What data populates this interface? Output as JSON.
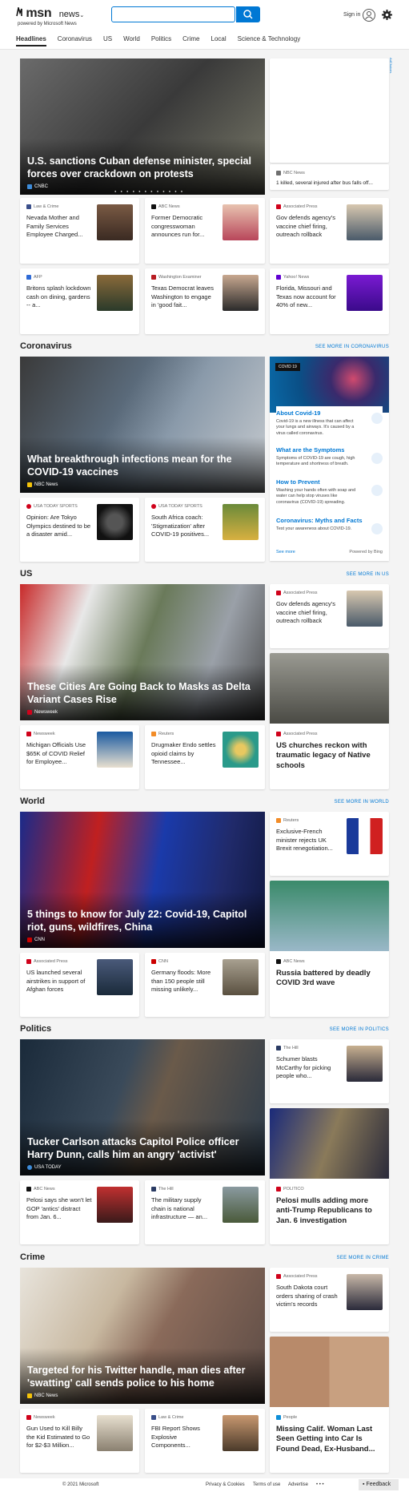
{
  "header": {
    "brand": "msn",
    "section": "news",
    "powered": "powered by Microsoft News",
    "search_placeholder": "",
    "signin": "Sign in"
  },
  "nav": [
    "Headlines",
    "Coronavirus",
    "US",
    "World",
    "Politics",
    "Crime",
    "Local",
    "Science & Technology"
  ],
  "adchoices": "AdChoices",
  "headlines": {
    "hero": {
      "title": "U.S. sanctions Cuban defense minister, special forces over crackdown on protests",
      "source": "CNBC"
    },
    "side_card": {
      "source": "NBC News",
      "title": "1 killed, several injured after bus falls off..."
    },
    "cards": [
      {
        "source": "Law & Crime",
        "title": "Nevada Mother and Family Services Employee Charged...",
        "color": "#3a4f8a"
      },
      {
        "source": "ABC News",
        "title": "Former Democratic congresswoman announces run for...",
        "color": "#111111"
      },
      {
        "source": "Associated Press",
        "title": "Gov defends agency's vaccine chief firing, outreach rollback",
        "color": "#d0021b"
      },
      {
        "source": "AFP",
        "title": "Britons splash lockdown cash on dining, gardens -- a...",
        "color": "#2f6bd6"
      },
      {
        "source": "Washington Examiner",
        "title": "Texas Democrat leaves Washington to engage in 'good fait...",
        "color": "#b81c22"
      },
      {
        "source": "Yahoo! News",
        "title": "Florida, Missouri and Texas now account for 40% of new...",
        "color": "#6001d2"
      }
    ]
  },
  "coronavirus": {
    "title": "Coronavirus",
    "see_more": "SEE MORE IN CORONAVIRUS",
    "hero": {
      "title": "What breakthrough infections mean for the COVID-19 vaccines",
      "source": "NBC News"
    },
    "cards": [
      {
        "source": "USA TODAY SPORTS",
        "title": "Opinion: Are Tokyo Olympics destined to be a disaster amid...",
        "color": "#d0021b"
      },
      {
        "source": "USA TODAY SPORTS",
        "title": "South Africa coach: 'Stigmatization' after COVID-19 positives...",
        "color": "#d0021b"
      }
    ],
    "panel": {
      "badge": "COVID 19",
      "items": [
        {
          "title": "About Covid-19",
          "desc": "Covid-19 is a new illness that can affect your lungs and airways. It's caused by a virus called coronavirus."
        },
        {
          "title": "What are the Symptoms",
          "desc": "Symptoms of COVID-19 are cough, high temperature and shortness of breath."
        },
        {
          "title": "How to Prevent",
          "desc": "Washing your hands often with soap and water can help stop viruses like coronavirus (COVID-19) spreading."
        },
        {
          "title": "Coronavirus: Myths and Facts",
          "desc": "Test your awareness about COVID-19."
        }
      ],
      "see_more": "See more",
      "powered": "Powered by Bing"
    }
  },
  "us": {
    "title": "US",
    "see_more": "SEE MORE IN US",
    "hero": {
      "title": "These Cities Are Going Back to Masks as Delta Variant Cases Rise",
      "source": "Newsweek"
    },
    "side_card": {
      "source": "Associated Press",
      "title": "Gov defends agency's vaccine chief firing, outreach rollback"
    },
    "cards": [
      {
        "source": "Newsweek",
        "title": "Michigan Officials Use $65K of COVID Relief for Employee...",
        "color": "#d0021b"
      },
      {
        "source": "Reuters",
        "title": "Drugmaker Endo settles opioid claims by Tennessee...",
        "color": "#f28c28"
      }
    ],
    "big_card": {
      "source": "Associated Press",
      "title": "US churches reckon with traumatic legacy of Native schools"
    }
  },
  "world": {
    "title": "World",
    "see_more": "SEE MORE IN WORLD",
    "hero": {
      "title": "5 things to know for July 22: Covid-19, Capitol riot, guns, wildfires, China",
      "source": "CNN"
    },
    "side_card": {
      "source": "Reuters",
      "title": "Exclusive-French minister rejects UK Brexit renegotiation..."
    },
    "cards": [
      {
        "source": "Associated Press",
        "title": "US launched several airstrikes in support of Afghan forces",
        "color": "#d0021b"
      },
      {
        "source": "CNN",
        "title": "Germany floods: More than 150 people still missing unlikely...",
        "color": "#cc0000"
      }
    ],
    "big_card": {
      "source": "ABC News",
      "title": "Russia battered by deadly COVID 3rd wave"
    }
  },
  "politics": {
    "title": "Politics",
    "see_more": "SEE MORE IN POLITICS",
    "hero": {
      "title": "Tucker Carlson attacks Capitol Police officer Harry Dunn, calls him an angry 'activist'",
      "source": "USA TODAY"
    },
    "side_card": {
      "source": "The Hill",
      "title": "Schumer blasts McCarthy for picking people who..."
    },
    "cards": [
      {
        "source": "ABC News",
        "title": "Pelosi says she won't let GOP 'antics' distract from Jan. 6...",
        "color": "#111111"
      },
      {
        "source": "The Hill",
        "title": "The military supply chain is national infrastructure — an...",
        "color": "#2a3b63"
      }
    ],
    "big_card": {
      "source": "POLITICO",
      "title": "Pelosi mulls adding more anti-Trump Republicans to Jan. 6 investigation"
    }
  },
  "crime": {
    "title": "Crime",
    "see_more": "SEE MORE IN CRIME",
    "hero": {
      "title": "Targeted for his Twitter handle, man dies after 'swatting' call sends police to his home",
      "source": "NBC News"
    },
    "side_card": {
      "source": "Associated Press",
      "title": "South Dakota court orders sharing of crash victim's records"
    },
    "cards": [
      {
        "source": "Newsweek",
        "title": "Gun Used to Kill Billy the Kid Estimated to Go for $2-$3 Million...",
        "color": "#d0021b"
      },
      {
        "source": "Law & Crime",
        "title": "FBI Report Shows Explosive Components...",
        "color": "#3a4f8a"
      }
    ],
    "big_card": {
      "source": "People",
      "title": "Missing Calif. Woman Last Seen Getting into Car Is Found Dead, Ex-Husband..."
    }
  },
  "footer": {
    "copyright": "© 2021 Microsoft",
    "privacy": "Privacy & Cookies",
    "terms": "Terms of use",
    "advertise": "Advertise",
    "more": "• • •",
    "feedback": "Feedback"
  }
}
